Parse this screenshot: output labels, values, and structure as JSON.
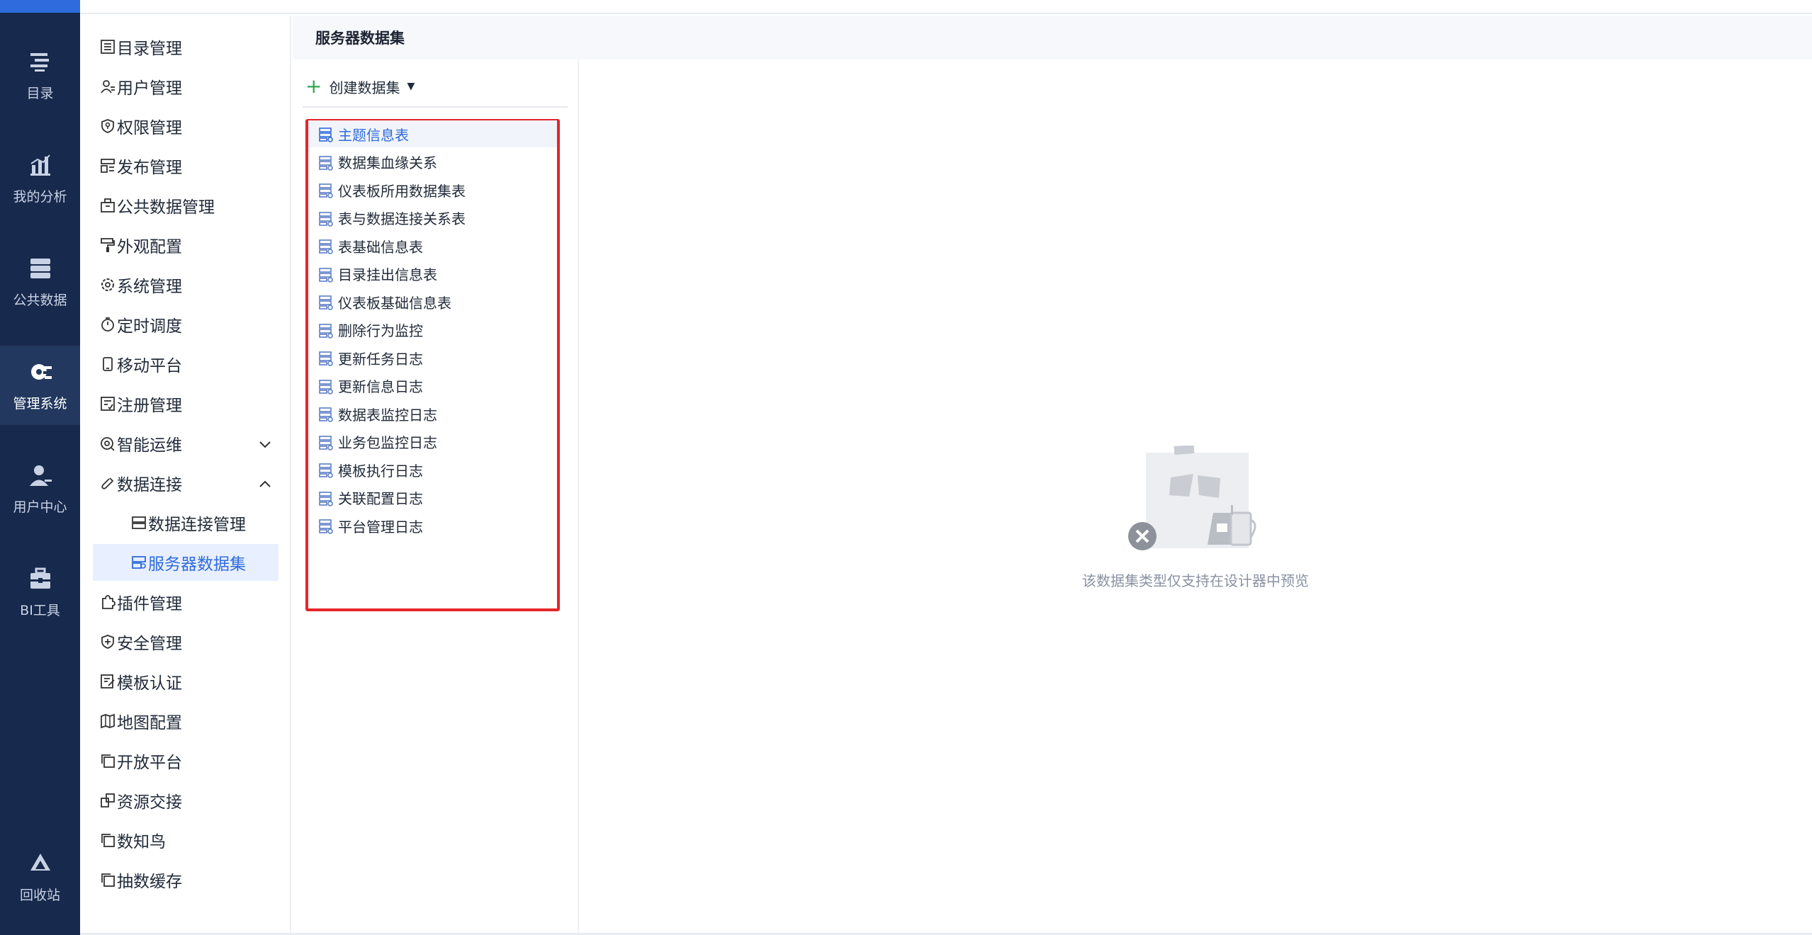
{
  "rail": {
    "items": [
      {
        "label": "目录",
        "icon": "catalog-icon"
      },
      {
        "label": "我的分析",
        "icon": "analysis-icon"
      },
      {
        "label": "公共数据",
        "icon": "public-data-icon"
      },
      {
        "label": "管理系统",
        "icon": "gear-icon",
        "active": true
      },
      {
        "label": "用户中心",
        "icon": "user-icon"
      },
      {
        "label": "BI工具",
        "icon": "toolbox-icon"
      },
      {
        "label": "回收站",
        "icon": "recycle-icon"
      }
    ]
  },
  "menu": {
    "items": [
      {
        "label": "目录管理",
        "icon": "list-icon"
      },
      {
        "label": "用户管理",
        "icon": "user-manage-icon"
      },
      {
        "label": "权限管理",
        "icon": "shield-key-icon"
      },
      {
        "label": "发布管理",
        "icon": "publish-icon"
      },
      {
        "label": "公共数据管理",
        "icon": "briefcase-icon"
      },
      {
        "label": "外观配置",
        "icon": "paint-roller-icon"
      },
      {
        "label": "系统管理",
        "icon": "settings-icon"
      },
      {
        "label": "定时调度",
        "icon": "timer-icon"
      },
      {
        "label": "移动平台",
        "icon": "mobile-icon"
      },
      {
        "label": "注册管理",
        "icon": "register-icon"
      },
      {
        "label": "智能运维",
        "icon": "ops-icon",
        "chevron": "down"
      },
      {
        "label": "数据连接",
        "icon": "link-icon",
        "chevron": "up"
      },
      {
        "label": "数据连接管理",
        "icon": "database-icon",
        "sub": true
      },
      {
        "label": "服务器数据集",
        "icon": "server-dataset-icon",
        "sub": true,
        "active": true
      },
      {
        "label": "插件管理",
        "icon": "plugin-icon"
      },
      {
        "label": "安全管理",
        "icon": "shield-plus-icon"
      },
      {
        "label": "模板认证",
        "icon": "template-auth-icon"
      },
      {
        "label": "地图配置",
        "icon": "map-icon"
      },
      {
        "label": "开放平台",
        "icon": "copy-icon"
      },
      {
        "label": "资源交接",
        "icon": "resource-icon"
      },
      {
        "label": "数知鸟",
        "icon": "copy-icon"
      },
      {
        "label": "抽数缓存",
        "icon": "copy-icon"
      }
    ]
  },
  "header": {
    "title": "服务器数据集"
  },
  "list": {
    "create_label": "创建数据集",
    "datasets": [
      "主题信息表",
      "数据集血缘关系",
      "仪表板所用数据集表",
      "表与数据连接关系表",
      "表基础信息表",
      "目录挂出信息表",
      "仪表板基础信息表",
      "删除行为监控",
      "更新任务日志",
      "更新信息日志",
      "数据表监控日志",
      "业务包监控日志",
      "模板执行日志",
      "关联配置日志",
      "平台管理日志"
    ],
    "active_index": 0
  },
  "preview": {
    "empty_text": "该数据集类型仅支持在设计器中预览"
  },
  "colors": {
    "rail_bg": "#17294d",
    "accent": "#2f6bdc",
    "highlight_border": "#e5252a"
  }
}
